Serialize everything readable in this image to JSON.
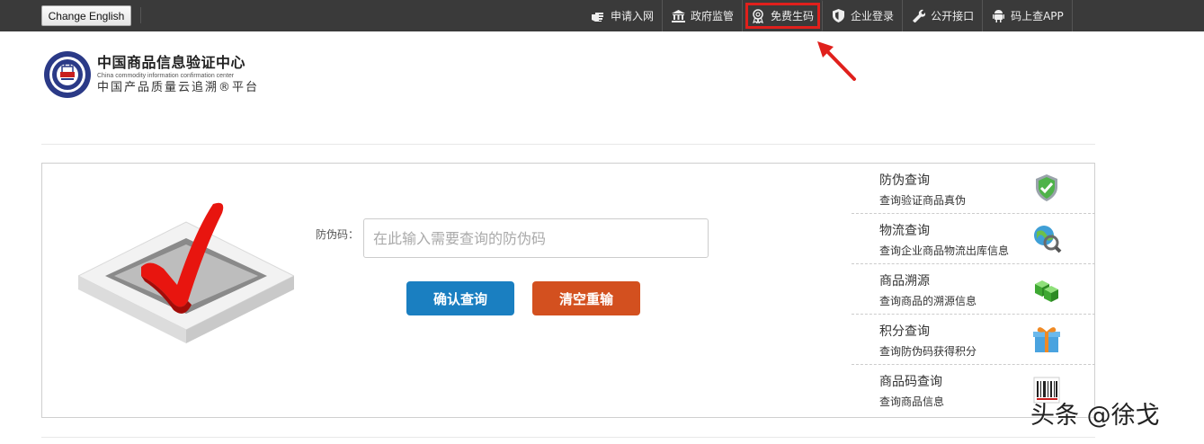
{
  "topbar": {
    "lang_button": "Change English",
    "nav": [
      {
        "label": "申请入网",
        "icon": "hand-pointer-icon"
      },
      {
        "label": "政府监管",
        "icon": "government-building-icon"
      },
      {
        "label": "免费生码",
        "icon": "award-badge-icon"
      },
      {
        "label": "企业登录",
        "icon": "shield-icon"
      },
      {
        "label": "公开接口",
        "icon": "wrench-icon"
      },
      {
        "label": "码上查APP",
        "icon": "android-icon"
      }
    ]
  },
  "logo": {
    "title": "中国商品信息验证中心",
    "subtitle_en": "China commodity information confirmation center",
    "platform": "中国产品质量云追溯®平台"
  },
  "form": {
    "label": "防伪码：",
    "placeholder": "在此输入需要查询的防伪码",
    "confirm_button": "确认查询",
    "clear_button": "清空重输"
  },
  "side_menu": [
    {
      "title": "防伪查询",
      "desc": "查询验证商品真伪",
      "icon": "shield-check-icon"
    },
    {
      "title": "物流查询",
      "desc": "查询企业商品物流出库信息",
      "icon": "globe-magnifier-icon"
    },
    {
      "title": "商品溯源",
      "desc": "查询商品的溯源信息",
      "icon": "green-cubes-icon"
    },
    {
      "title": "积分查询",
      "desc": "查询防伪码获得积分",
      "icon": "gift-box-icon"
    },
    {
      "title": "商品码查询",
      "desc": "查询商品信息",
      "icon": "barcode-icon"
    }
  ],
  "watermark": "头条 @徐戈",
  "colors": {
    "topbar": "#3a3a3a",
    "confirm": "#1a7fc1",
    "clear": "#d3501f",
    "highlight": "#e0201c"
  }
}
